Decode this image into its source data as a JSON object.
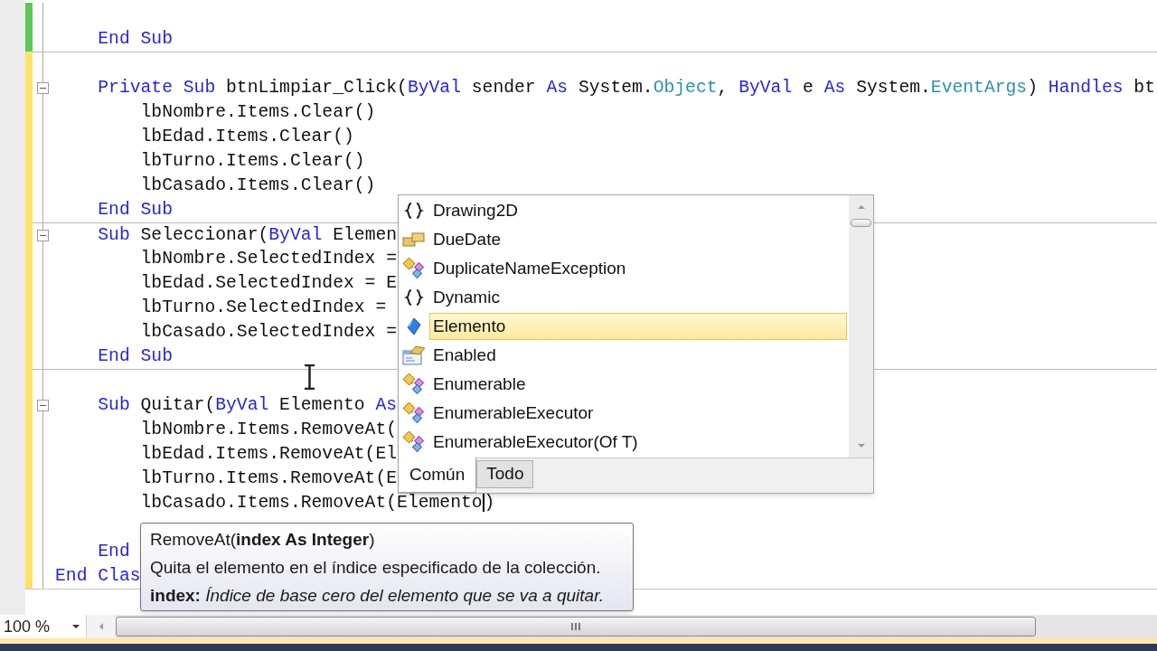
{
  "editor": {
    "lines": [
      {
        "saved": true,
        "separator": false,
        "collapsible": false
      },
      {
        "saved": true,
        "separator": false,
        "collapsible": false,
        "tokens": [
          {
            "text": "    End Sub",
            "kind": "keyword"
          }
        ]
      },
      {
        "saved": false,
        "separator": true,
        "collapsible": false
      },
      {
        "saved": false,
        "separator": false,
        "collapsible": true,
        "tokens": [
          {
            "text": "    Private Sub ",
            "kind": "keyword"
          },
          {
            "text": "btnLimpiar_Click(",
            "kind": "plain"
          },
          {
            "text": "ByVal",
            "kind": "keyword"
          },
          {
            "text": " sender ",
            "kind": "plain"
          },
          {
            "text": "As",
            "kind": "keyword"
          },
          {
            "text": " System.",
            "kind": "plain"
          },
          {
            "text": "Object",
            "kind": "type"
          },
          {
            "text": ", ",
            "kind": "plain"
          },
          {
            "text": "ByVal",
            "kind": "keyword"
          },
          {
            "text": " e ",
            "kind": "plain"
          },
          {
            "text": "As",
            "kind": "keyword"
          },
          {
            "text": " System.",
            "kind": "plain"
          },
          {
            "text": "EventArgs",
            "kind": "type"
          },
          {
            "text": ") ",
            "kind": "plain"
          },
          {
            "text": "Handles",
            "kind": "keyword"
          },
          {
            "text": " bt",
            "kind": "plain"
          }
        ]
      },
      {
        "saved": false,
        "separator": false,
        "collapsible": false,
        "tokens": [
          {
            "text": "        lbNombre.Items.Clear()",
            "kind": "plain"
          }
        ]
      },
      {
        "saved": false,
        "separator": false,
        "collapsible": false,
        "tokens": [
          {
            "text": "        lbEdad.Items.Clear()",
            "kind": "plain"
          }
        ]
      },
      {
        "saved": false,
        "separator": false,
        "collapsible": false,
        "tokens": [
          {
            "text": "        lbTurno.Items.Clear()",
            "kind": "plain"
          }
        ]
      },
      {
        "saved": false,
        "separator": false,
        "collapsible": false,
        "tokens": [
          {
            "text": "        lbCasado.Items.Clear()",
            "kind": "plain"
          }
        ]
      },
      {
        "saved": false,
        "separator": false,
        "collapsible": false,
        "tokens": [
          {
            "text": "    End Sub",
            "kind": "keyword"
          }
        ]
      },
      {
        "saved": false,
        "separator": true,
        "collapsible": true,
        "tokens": [
          {
            "text": "    Sub ",
            "kind": "keyword"
          },
          {
            "text": "Seleccionar(",
            "kind": "plain"
          },
          {
            "text": "ByVal",
            "kind": "keyword"
          },
          {
            "text": " Elemen",
            "kind": "plain"
          }
        ]
      },
      {
        "saved": false,
        "separator": false,
        "collapsible": false,
        "tokens": [
          {
            "text": "        lbNombre.SelectedIndex =",
            "kind": "plain"
          }
        ]
      },
      {
        "saved": false,
        "separator": false,
        "collapsible": false,
        "tokens": [
          {
            "text": "        lbEdad.SelectedIndex = E",
            "kind": "plain"
          }
        ]
      },
      {
        "saved": false,
        "separator": false,
        "collapsible": false,
        "tokens": [
          {
            "text": "        lbTurno.SelectedIndex =",
            "kind": "plain"
          }
        ]
      },
      {
        "saved": false,
        "separator": false,
        "collapsible": false,
        "tokens": [
          {
            "text": "        lbCasado.SelectedIndex =",
            "kind": "plain"
          }
        ]
      },
      {
        "saved": false,
        "separator": false,
        "collapsible": false,
        "tokens": [
          {
            "text": "    End Sub",
            "kind": "keyword"
          }
        ]
      },
      {
        "saved": false,
        "separator": true,
        "collapsible": false
      },
      {
        "saved": false,
        "separator": false,
        "collapsible": true,
        "tokens": [
          {
            "text": "    Sub ",
            "kind": "keyword"
          },
          {
            "text": "Quitar(",
            "kind": "plain"
          },
          {
            "text": "ByVal",
            "kind": "keyword"
          },
          {
            "text": " Elemento ",
            "kind": "plain"
          },
          {
            "text": "As",
            "kind": "keyword"
          }
        ]
      },
      {
        "saved": false,
        "separator": false,
        "collapsible": false,
        "tokens": [
          {
            "text": "        lbNombre.Items.RemoveAt(",
            "kind": "plain"
          }
        ]
      },
      {
        "saved": false,
        "separator": false,
        "collapsible": false,
        "tokens": [
          {
            "text": "        lbEdad.Items.RemoveAt(El",
            "kind": "plain"
          }
        ]
      },
      {
        "saved": false,
        "separator": false,
        "collapsible": false,
        "tokens": [
          {
            "text": "        lbTurno.Items.RemoveAt(E",
            "kind": "plain"
          }
        ]
      },
      {
        "saved": false,
        "separator": false,
        "collapsible": false,
        "tokens": [
          {
            "text": "        lbCasado.Items.RemoveAt(Elemento",
            "kind": "plain"
          },
          {
            "kind": "caret"
          },
          {
            "text": ")",
            "kind": "plain"
          }
        ]
      },
      {
        "saved": false,
        "separator": false,
        "collapsible": false
      },
      {
        "saved": false,
        "separator": false,
        "collapsible": false,
        "tokens": [
          {
            "text": "    End",
            "kind": "keyword"
          }
        ]
      },
      {
        "saved": false,
        "separator": false,
        "collapsible": false,
        "tokens": [
          {
            "text": "End Clas",
            "kind": "keyword"
          }
        ]
      }
    ]
  },
  "completion_list": {
    "items": [
      {
        "label": "Drawing2D",
        "kind": "namespace",
        "selected": false
      },
      {
        "label": "DueDate",
        "kind": "property",
        "selected": false
      },
      {
        "label": "DuplicateNameException",
        "kind": "class",
        "selected": false
      },
      {
        "label": "Dynamic",
        "kind": "namespace",
        "selected": false
      },
      {
        "label": "Elemento",
        "kind": "local",
        "selected": true
      },
      {
        "label": "Enabled",
        "kind": "form-property",
        "selected": false
      },
      {
        "label": "Enumerable",
        "kind": "class",
        "selected": false
      },
      {
        "label": "EnumerableExecutor",
        "kind": "class",
        "selected": false
      },
      {
        "label": "EnumerableExecutor(Of T)",
        "kind": "class",
        "selected": false
      }
    ],
    "tabs": [
      {
        "label": "Común",
        "selected": true
      },
      {
        "label": "Todo",
        "selected": false
      }
    ]
  },
  "parameter_tooltip": {
    "signature": "RemoveAt(**index As Integer**)",
    "description": "Quita el elemento en el índice especificado de la colección.",
    "parameter": "**index:** *Índice de base cero del elemento que se va a quitar.*"
  },
  "zoom": {
    "value": "100 %"
  }
}
